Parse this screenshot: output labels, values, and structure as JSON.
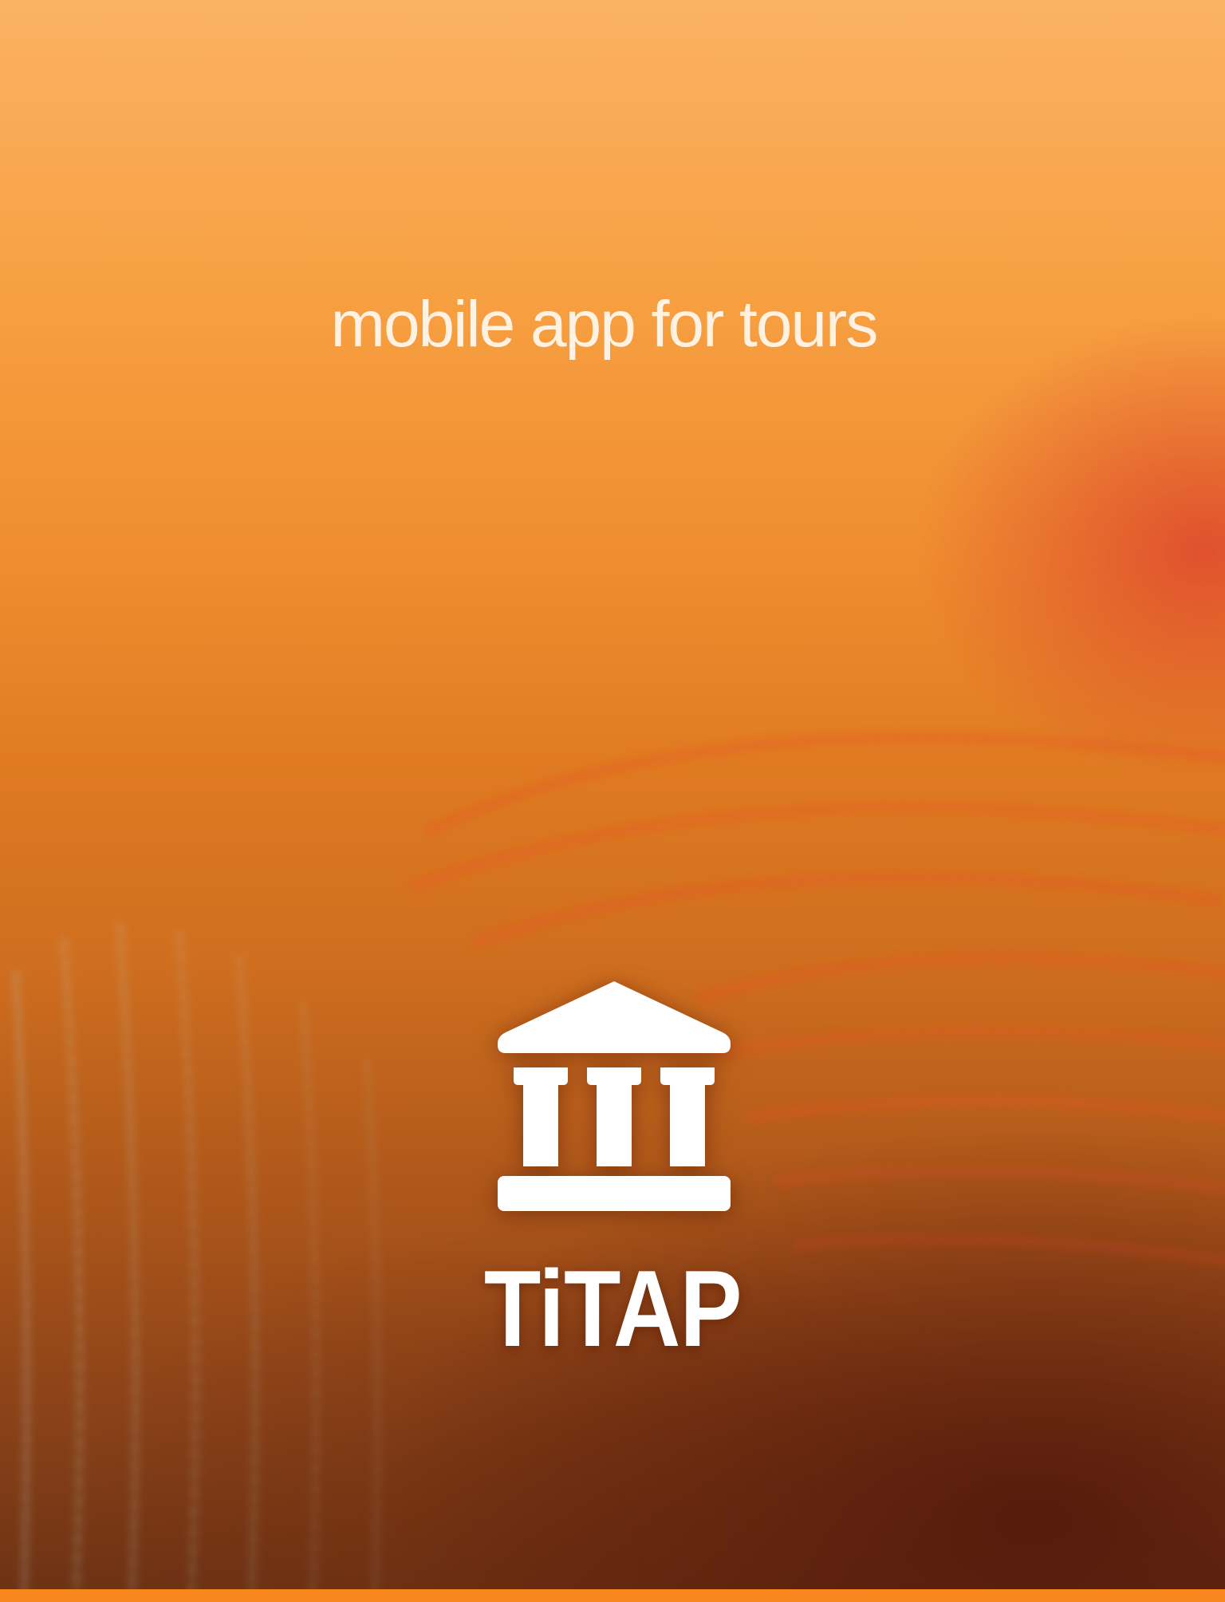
{
  "splash": {
    "tagline": "mobile app for tours",
    "brand_name": "TiTAP",
    "logo_icon": "museum-building-icon"
  },
  "colors": {
    "background_top": "#fbb264",
    "background_bottom": "#6b3114",
    "accent_bar": "#f7861c",
    "text": "#ffffff"
  }
}
